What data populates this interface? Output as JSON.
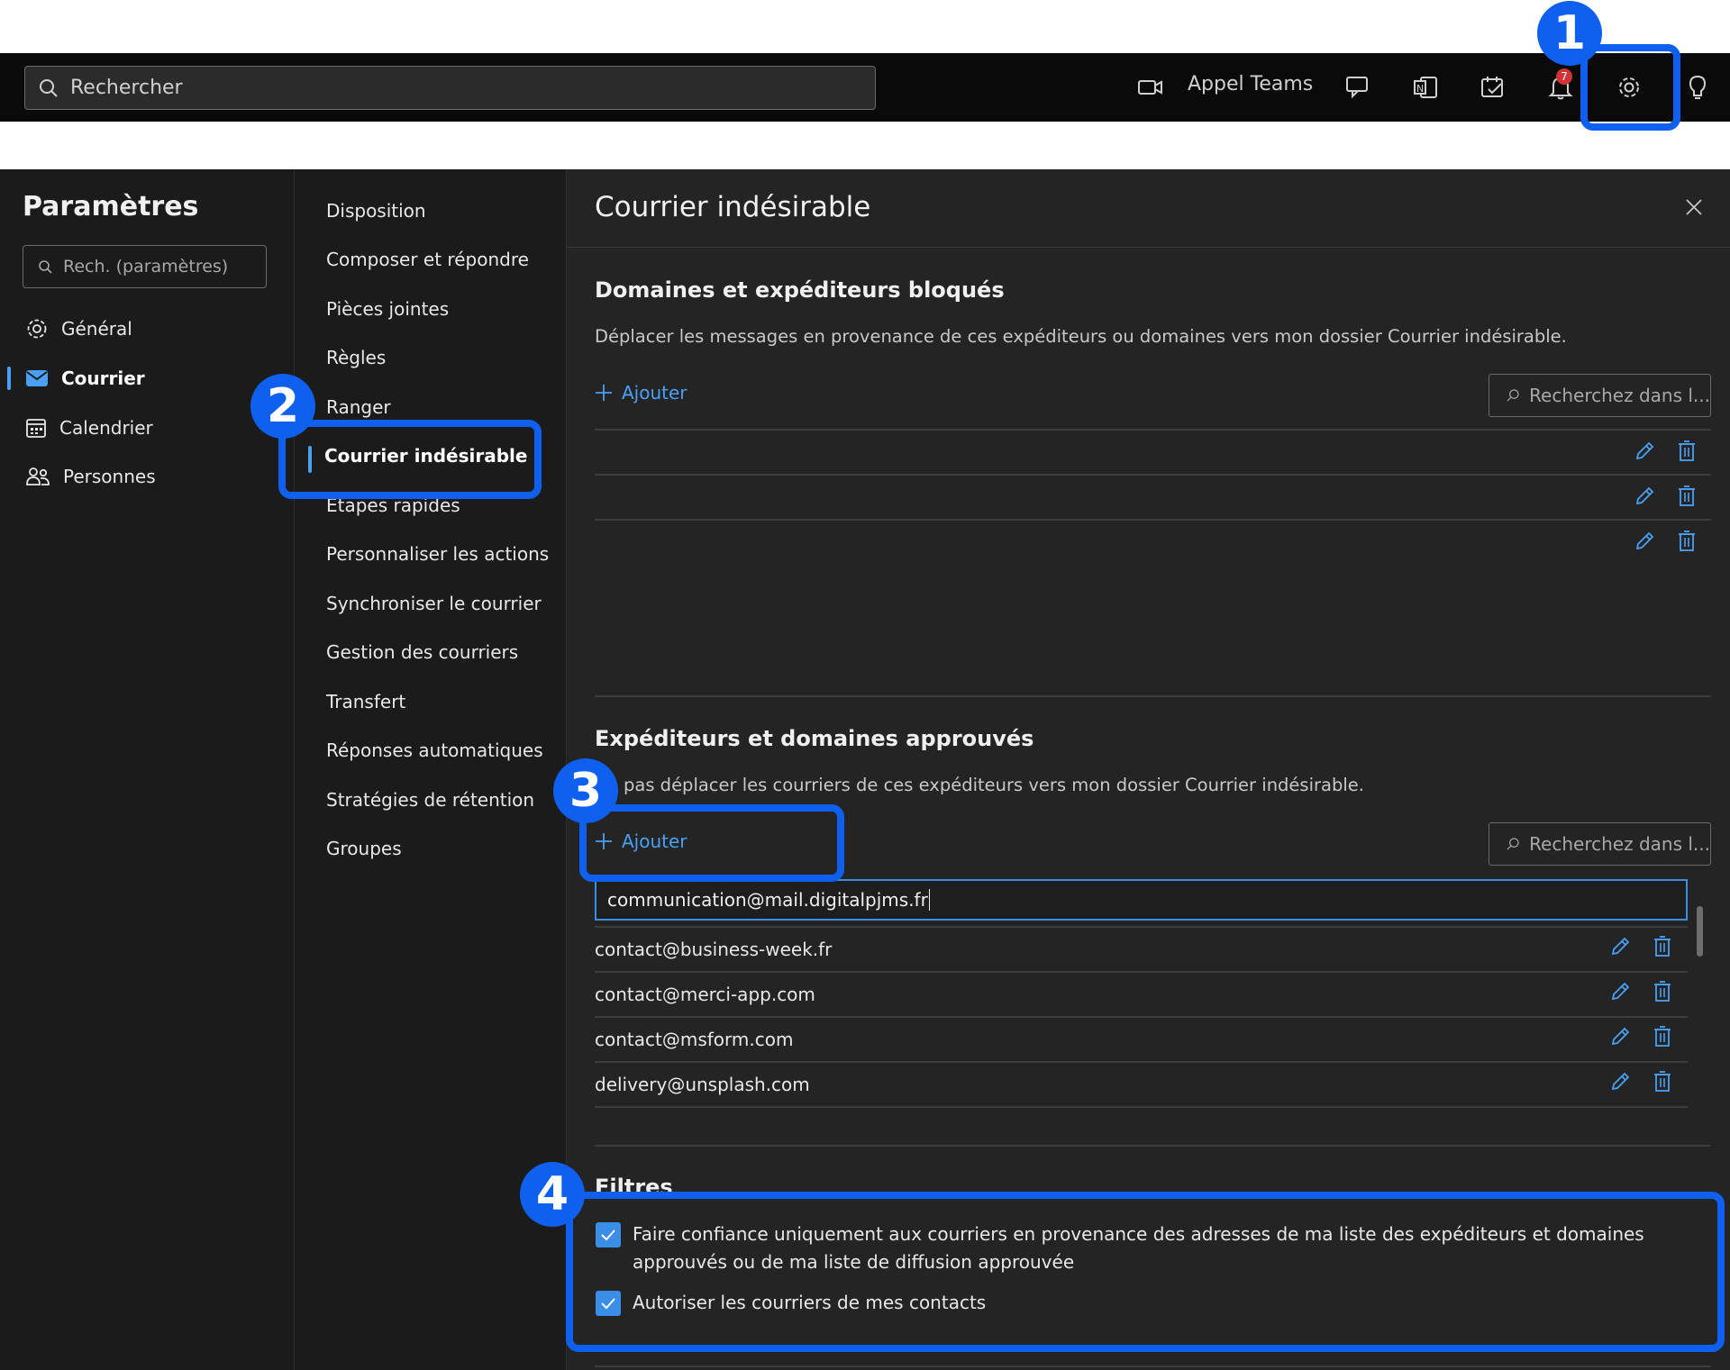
{
  "topbar": {
    "search_placeholder": "Rechercher",
    "teams_label": "Appel Teams",
    "notification_count": "7",
    "icons": [
      "video-icon",
      "feedback-icon",
      "onenote-icon",
      "todo-icon",
      "bell-icon",
      "gear-icon",
      "lightbulb-icon"
    ]
  },
  "settings": {
    "title": "Paramètres",
    "search_placeholder": "Rech. (paramètres)",
    "nav": [
      {
        "label": "Général",
        "icon": "gear-icon"
      },
      {
        "label": "Courrier",
        "icon": "mail-icon",
        "active": true
      },
      {
        "label": "Calendrier",
        "icon": "calendar-icon"
      },
      {
        "label": "Personnes",
        "icon": "people-icon"
      }
    ]
  },
  "mail_nav": [
    "Disposition",
    "Composer et répondre",
    "Pièces jointes",
    "Règles",
    "Ranger",
    "Courrier indésirable",
    "Etapes rapides",
    "Personnaliser les actions",
    "Synchroniser le courrier",
    "Gestion des courriers",
    "Transfert",
    "Réponses automatiques",
    "Stratégies de rétention",
    "Groupes"
  ],
  "pane": {
    "title": "Courrier indésirable",
    "blocked": {
      "title": "Domaines et expéditeurs bloqués",
      "description": "Déplacer les messages en provenance de ces expéditeurs ou domaines vers mon dossier Courrier indésirable.",
      "add_label": "Ajouter",
      "search_placeholder": "Recherchez dans l..."
    },
    "approved": {
      "title": "Expéditeurs et domaines approuvés",
      "description": "pas déplacer les courriers de ces expéditeurs vers mon dossier Courrier indésirable.",
      "add_label": "Ajouter",
      "search_placeholder": "Recherchez dans l...",
      "new_entry_value": "communication@mail.digitalpjms.fr",
      "entries": [
        "contact@business-week.fr",
        "contact@merci-app.com",
        "contact@msform.com",
        "delivery@unsplash.com"
      ]
    },
    "filters": {
      "title": "Filtres",
      "options": [
        {
          "label": "Faire confiance uniquement aux courriers en provenance des adresses de ma liste des expéditeurs et domaines approuvés ou de ma liste de diffusion approuvée",
          "checked": true
        },
        {
          "label": "Autoriser les courriers de mes contacts",
          "checked": true
        }
      ]
    }
  },
  "annotations": {
    "step_1": "1",
    "step_2": "2",
    "step_3": "3",
    "step_4": "4",
    "highlight_color": "#1060f0"
  }
}
